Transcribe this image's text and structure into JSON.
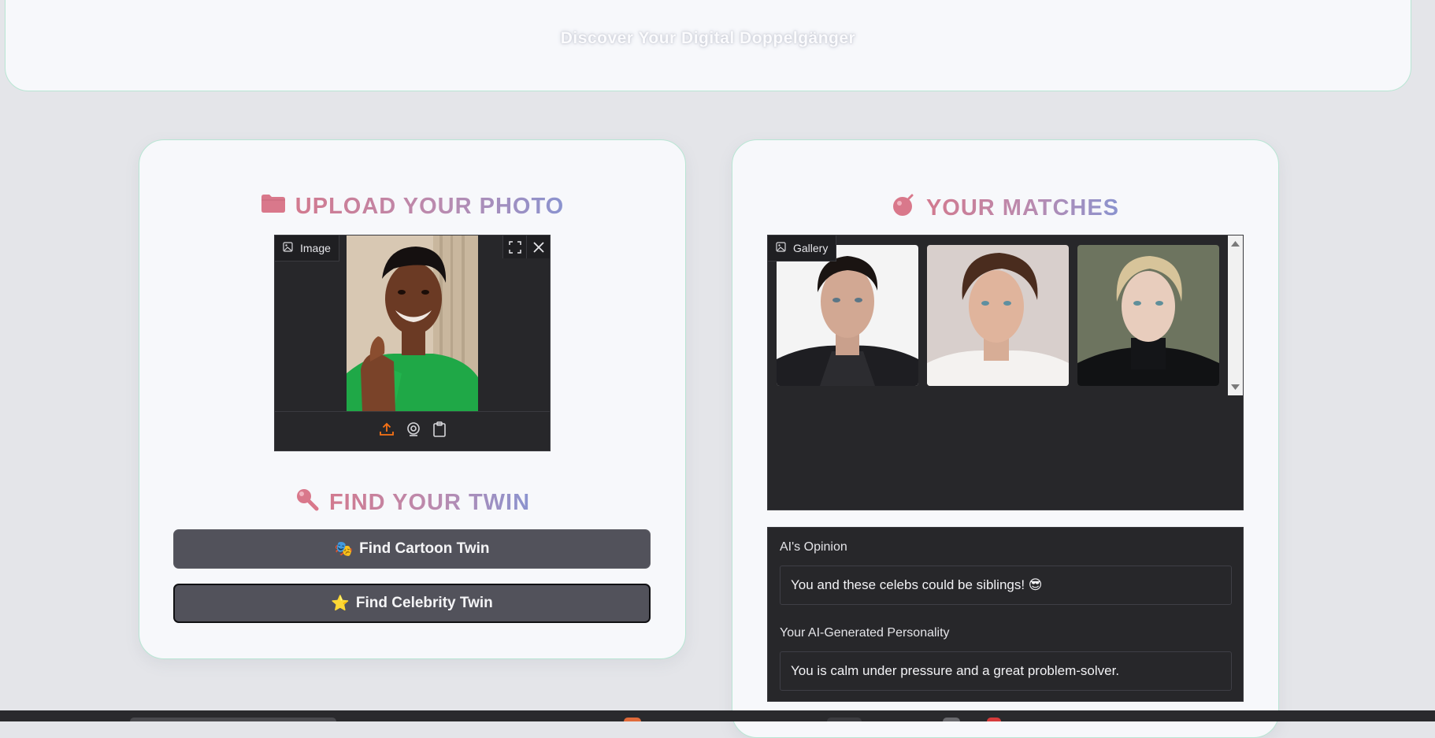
{
  "header": {
    "subtitle": "Discover Your Digital Doppelgänger"
  },
  "upload_panel": {
    "title": "UPLOAD YOUR PHOTO",
    "title_icon": "folder-icon",
    "image_component": {
      "label": "Image",
      "tools": [
        "fullscreen-icon",
        "close-icon"
      ],
      "sources": [
        "upload-icon",
        "webcam-icon",
        "clipboard-icon"
      ]
    },
    "find_title": "FIND YOUR TWIN",
    "find_icon": "magnifier-icon",
    "buttons": {
      "cartoon": {
        "emoji": "🎭",
        "label": "Find Cartoon Twin"
      },
      "celebrity": {
        "emoji": "⭐",
        "label": "Find Celebrity Twin"
      }
    }
  },
  "matches_panel": {
    "title": "YOUR MATCHES",
    "title_icon": "bomb-icon",
    "gallery": {
      "label": "Gallery",
      "thumbnails": [
        "celebrity-match-1",
        "celebrity-match-2",
        "celebrity-match-3"
      ]
    },
    "opinion": {
      "label": "AI's Opinion",
      "value": "You and these celebs could be siblings! 😎"
    },
    "personality": {
      "label": "Your AI-Generated Personality",
      "value": "You is calm under pressure and a great problem-solver."
    }
  },
  "colors": {
    "panel_bg": "#f7f8fb",
    "panel_border": "#b9e6d4",
    "title_gradient_start": "#d27a8f",
    "title_gradient_end": "#8a93cf",
    "dark_component": "#27272a",
    "button_bg": "#52525b",
    "upload_accent": "#f97316"
  }
}
